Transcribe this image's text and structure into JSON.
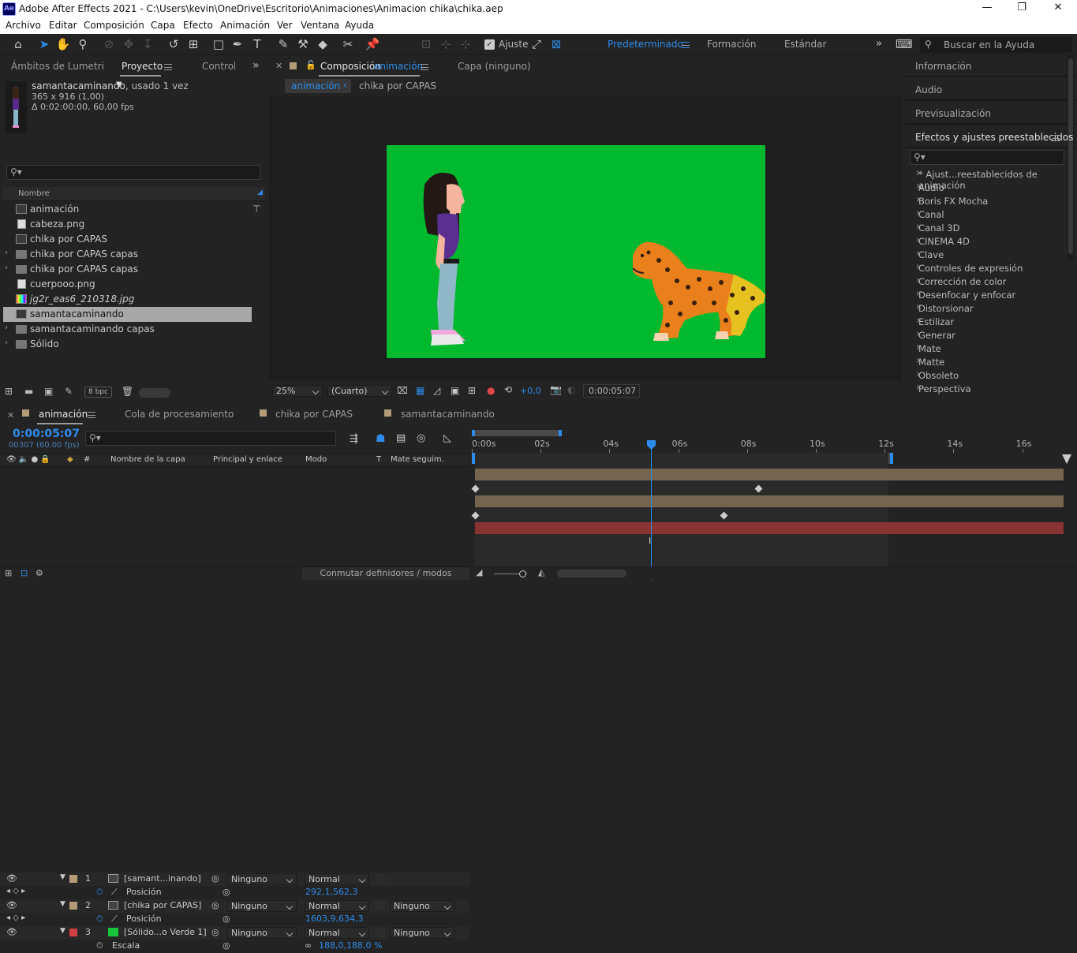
{
  "window": {
    "title": "Adobe After Effects 2021 - C:\\Users\\kevin\\OneDrive\\Escritorio\\Animaciones\\Animacion chika\\chika.aep",
    "logo": "Ae"
  },
  "menu": [
    "Archivo",
    "Editar",
    "Composición",
    "Capa",
    "Efecto",
    "Animación",
    "Ver",
    "Ventana",
    "Ayuda"
  ],
  "toolbar": {
    "snap_label": "Ajuste",
    "workspaces": [
      "Predeterminado",
      "Formación",
      "Estándar"
    ],
    "help_search": "Buscar en la Ayuda"
  },
  "project_panel": {
    "tabs": [
      "Ámbitos de Lumetri",
      "Proyecto",
      "Controle"
    ],
    "selected_name": "samantacaminando",
    "usage": ", usado 1 vez",
    "dims": "365 x 916 (1,00)",
    "duration": "Δ 0:02:00:00, 60,00 fps",
    "column_name": "Nombre",
    "items": [
      {
        "name": "animación",
        "type": "comp"
      },
      {
        "name": "cabeza.png",
        "type": "png"
      },
      {
        "name": "chika por CAPAS",
        "type": "comp"
      },
      {
        "name": "chika por CAPAS capas",
        "type": "folder"
      },
      {
        "name": "chika por CAPAS capas",
        "type": "folder"
      },
      {
        "name": "cuerpooo.png",
        "type": "png"
      },
      {
        "name": "jg2r_eas6_210318.jpg",
        "type": "jpg"
      },
      {
        "name": "samantacaminando",
        "type": "comp"
      },
      {
        "name": "samantacaminando capas",
        "type": "folder"
      },
      {
        "name": "Sólido",
        "type": "folder"
      }
    ],
    "bpc": "8 bpc"
  },
  "comp_panel": {
    "tab_prefix": "Composición",
    "tab_name": "animación",
    "layer_tab": "Capa  (ninguno)",
    "breadcrumbs": [
      "animación",
      "chika por CAPAS"
    ],
    "zoom": "25%",
    "resolution": "(Cuarto)",
    "exposure": "+0,0",
    "timecode": "0:00:05:07",
    "bg_color": "#00b92e"
  },
  "right_panel": {
    "tabs": [
      "Información",
      "Audio",
      "Previsualización"
    ],
    "effects_title": "Efectos y ajustes preestablecidos",
    "effects": [
      "* Ajust...reestablecidos de animación",
      "Audio",
      "Boris FX Mocha",
      "Canal",
      "Canal 3D",
      "CINEMA 4D",
      "Clave",
      "Controles de expresión",
      "Corrección de color",
      "Desenfocar y enfocar",
      "Distorsionar",
      "Estilizar",
      "Generar",
      "Mate",
      "Matte",
      "Obsoleto",
      "Perspectiva"
    ]
  },
  "timeline": {
    "tabs": [
      "animación",
      "Cola de procesamiento",
      "chika por CAPAS",
      "samantacaminando"
    ],
    "timecode": "0:00:05:07",
    "frame": "00307 (60.00 fps)",
    "columns": [
      "#",
      "Nombre de la capa",
      "Principal y enlace",
      "Modo",
      "T",
      "Mate seguim."
    ],
    "ruler": [
      "0:00s",
      "02s",
      "04s",
      "06s",
      "08s",
      "10s",
      "12s",
      "14s",
      "16s"
    ],
    "layers": [
      {
        "num": "1",
        "name": "[samant...inando]",
        "parent": "Ninguno",
        "mode": "Normal",
        "matte": "",
        "prop": "Posición",
        "value": "292,1,562,3",
        "color": "#b39b77"
      },
      {
        "num": "2",
        "name": "[chika por CAPAS]",
        "parent": "Ninguno",
        "mode": "Normal",
        "matte": "Ninguno",
        "prop": "Posición",
        "value": "1603,9,634,3",
        "color": "#b39b77"
      },
      {
        "num": "3",
        "name": "[Sólido...o Verde 1]",
        "parent": "Ninguno",
        "mode": "Normal",
        "matte": "Ninguno",
        "prop": "Escala",
        "value": "188,0,188,0 %",
        "color": "#d04040"
      }
    ],
    "footer": "Conmutar definidores / modos"
  }
}
